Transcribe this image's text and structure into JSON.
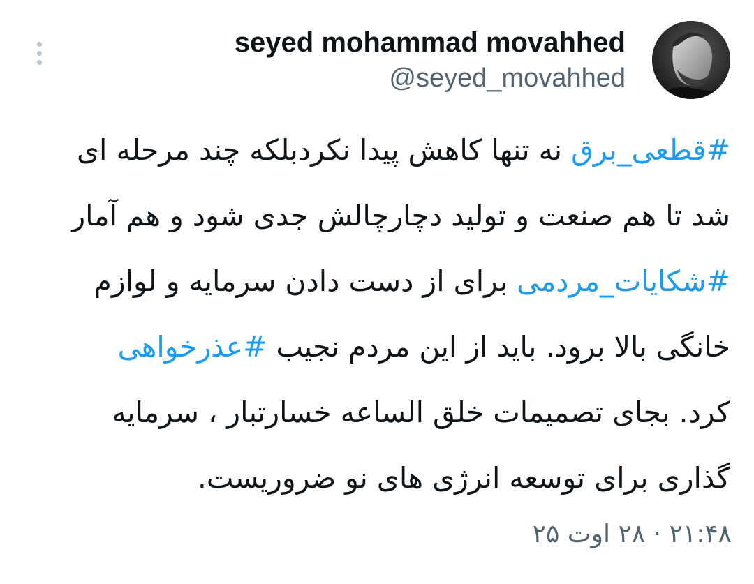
{
  "tweet": {
    "author": {
      "display_name": "seyed mohammad movahhed",
      "handle": "@seyed_movahhed"
    },
    "more_icon": "more-vertical-icon",
    "lines": [
      [
        {
          "text": "#قطعی_برق",
          "hashtag": true
        },
        {
          "text": " نه تنها کاهش پیدا نکردبلکه چند مرحله ای"
        }
      ],
      [
        {
          "text": "شد تا هم صنعت و تولید دچارچالش جدی شود و هم آمار"
        }
      ],
      [
        {
          "text": "#شکایات_مردمی",
          "hashtag": true
        },
        {
          "text": " برای از دست دادن سرمایه و لوازم"
        }
      ],
      [
        {
          "text": "خانگی بالا برود. باید از این مردم نجیب "
        },
        {
          "text": "#عذرخواهی",
          "hashtag": true
        }
      ],
      [
        {
          "text": "کرد. بجای تصمیمات خلق الساعه خسارتبار ، سرمایه"
        }
      ],
      [
        {
          "text": "گذاری برای توسعه انرژی های نو ضروریست."
        }
      ]
    ],
    "timestamp": "۲۱:۴۸ · ۲۸ اوت ۲۵"
  },
  "colors": {
    "text": "#0f1419",
    "secondary": "#536471",
    "hashtag": "#1d9bf0"
  }
}
